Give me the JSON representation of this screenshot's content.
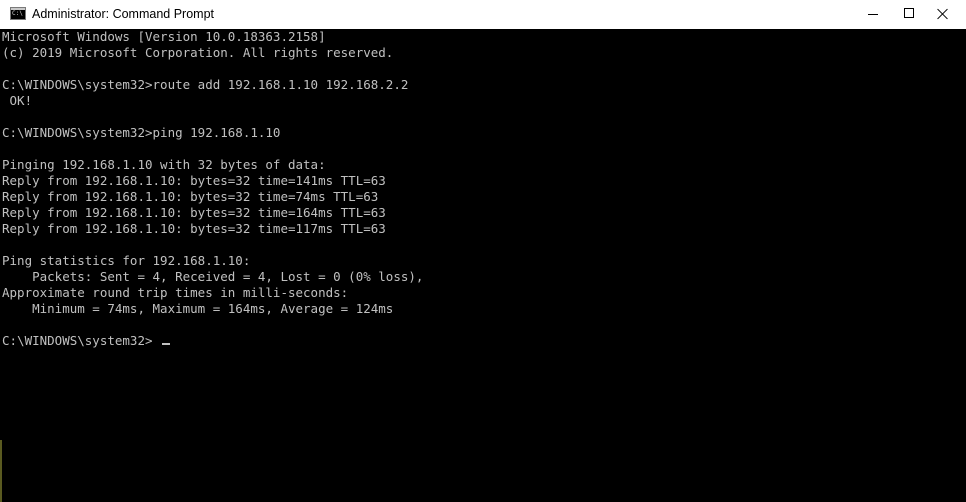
{
  "window": {
    "title": "Administrator: Command Prompt"
  },
  "icons": {
    "app": "command-prompt-icon",
    "minimize": "minimize-icon",
    "maximize": "maximize-icon",
    "close": "close-icon"
  },
  "console": {
    "lines": [
      "Microsoft Windows [Version 10.0.18363.2158]",
      "(c) 2019 Microsoft Corporation. All rights reserved.",
      "",
      "C:\\WINDOWS\\system32>route add 192.168.1.10 192.168.2.2",
      " OK!",
      "",
      "C:\\WINDOWS\\system32>ping 192.168.1.10",
      "",
      "Pinging 192.168.1.10 with 32 bytes of data:",
      "Reply from 192.168.1.10: bytes=32 time=141ms TTL=63",
      "Reply from 192.168.1.10: bytes=32 time=74ms TTL=63",
      "Reply from 192.168.1.10: bytes=32 time=164ms TTL=63",
      "Reply from 192.168.1.10: bytes=32 time=117ms TTL=63",
      "",
      "Ping statistics for 192.168.1.10:",
      "    Packets: Sent = 4, Received = 4, Lost = 0 (0% loss),",
      "Approximate round trip times in milli-seconds:",
      "    Minimum = 74ms, Maximum = 164ms, Average = 124ms",
      "",
      "C:\\WINDOWS\\system32>"
    ]
  },
  "colors": {
    "console_background": "#000000",
    "console_text": "#c0c0c0",
    "titlebar_background": "#ffffff"
  }
}
